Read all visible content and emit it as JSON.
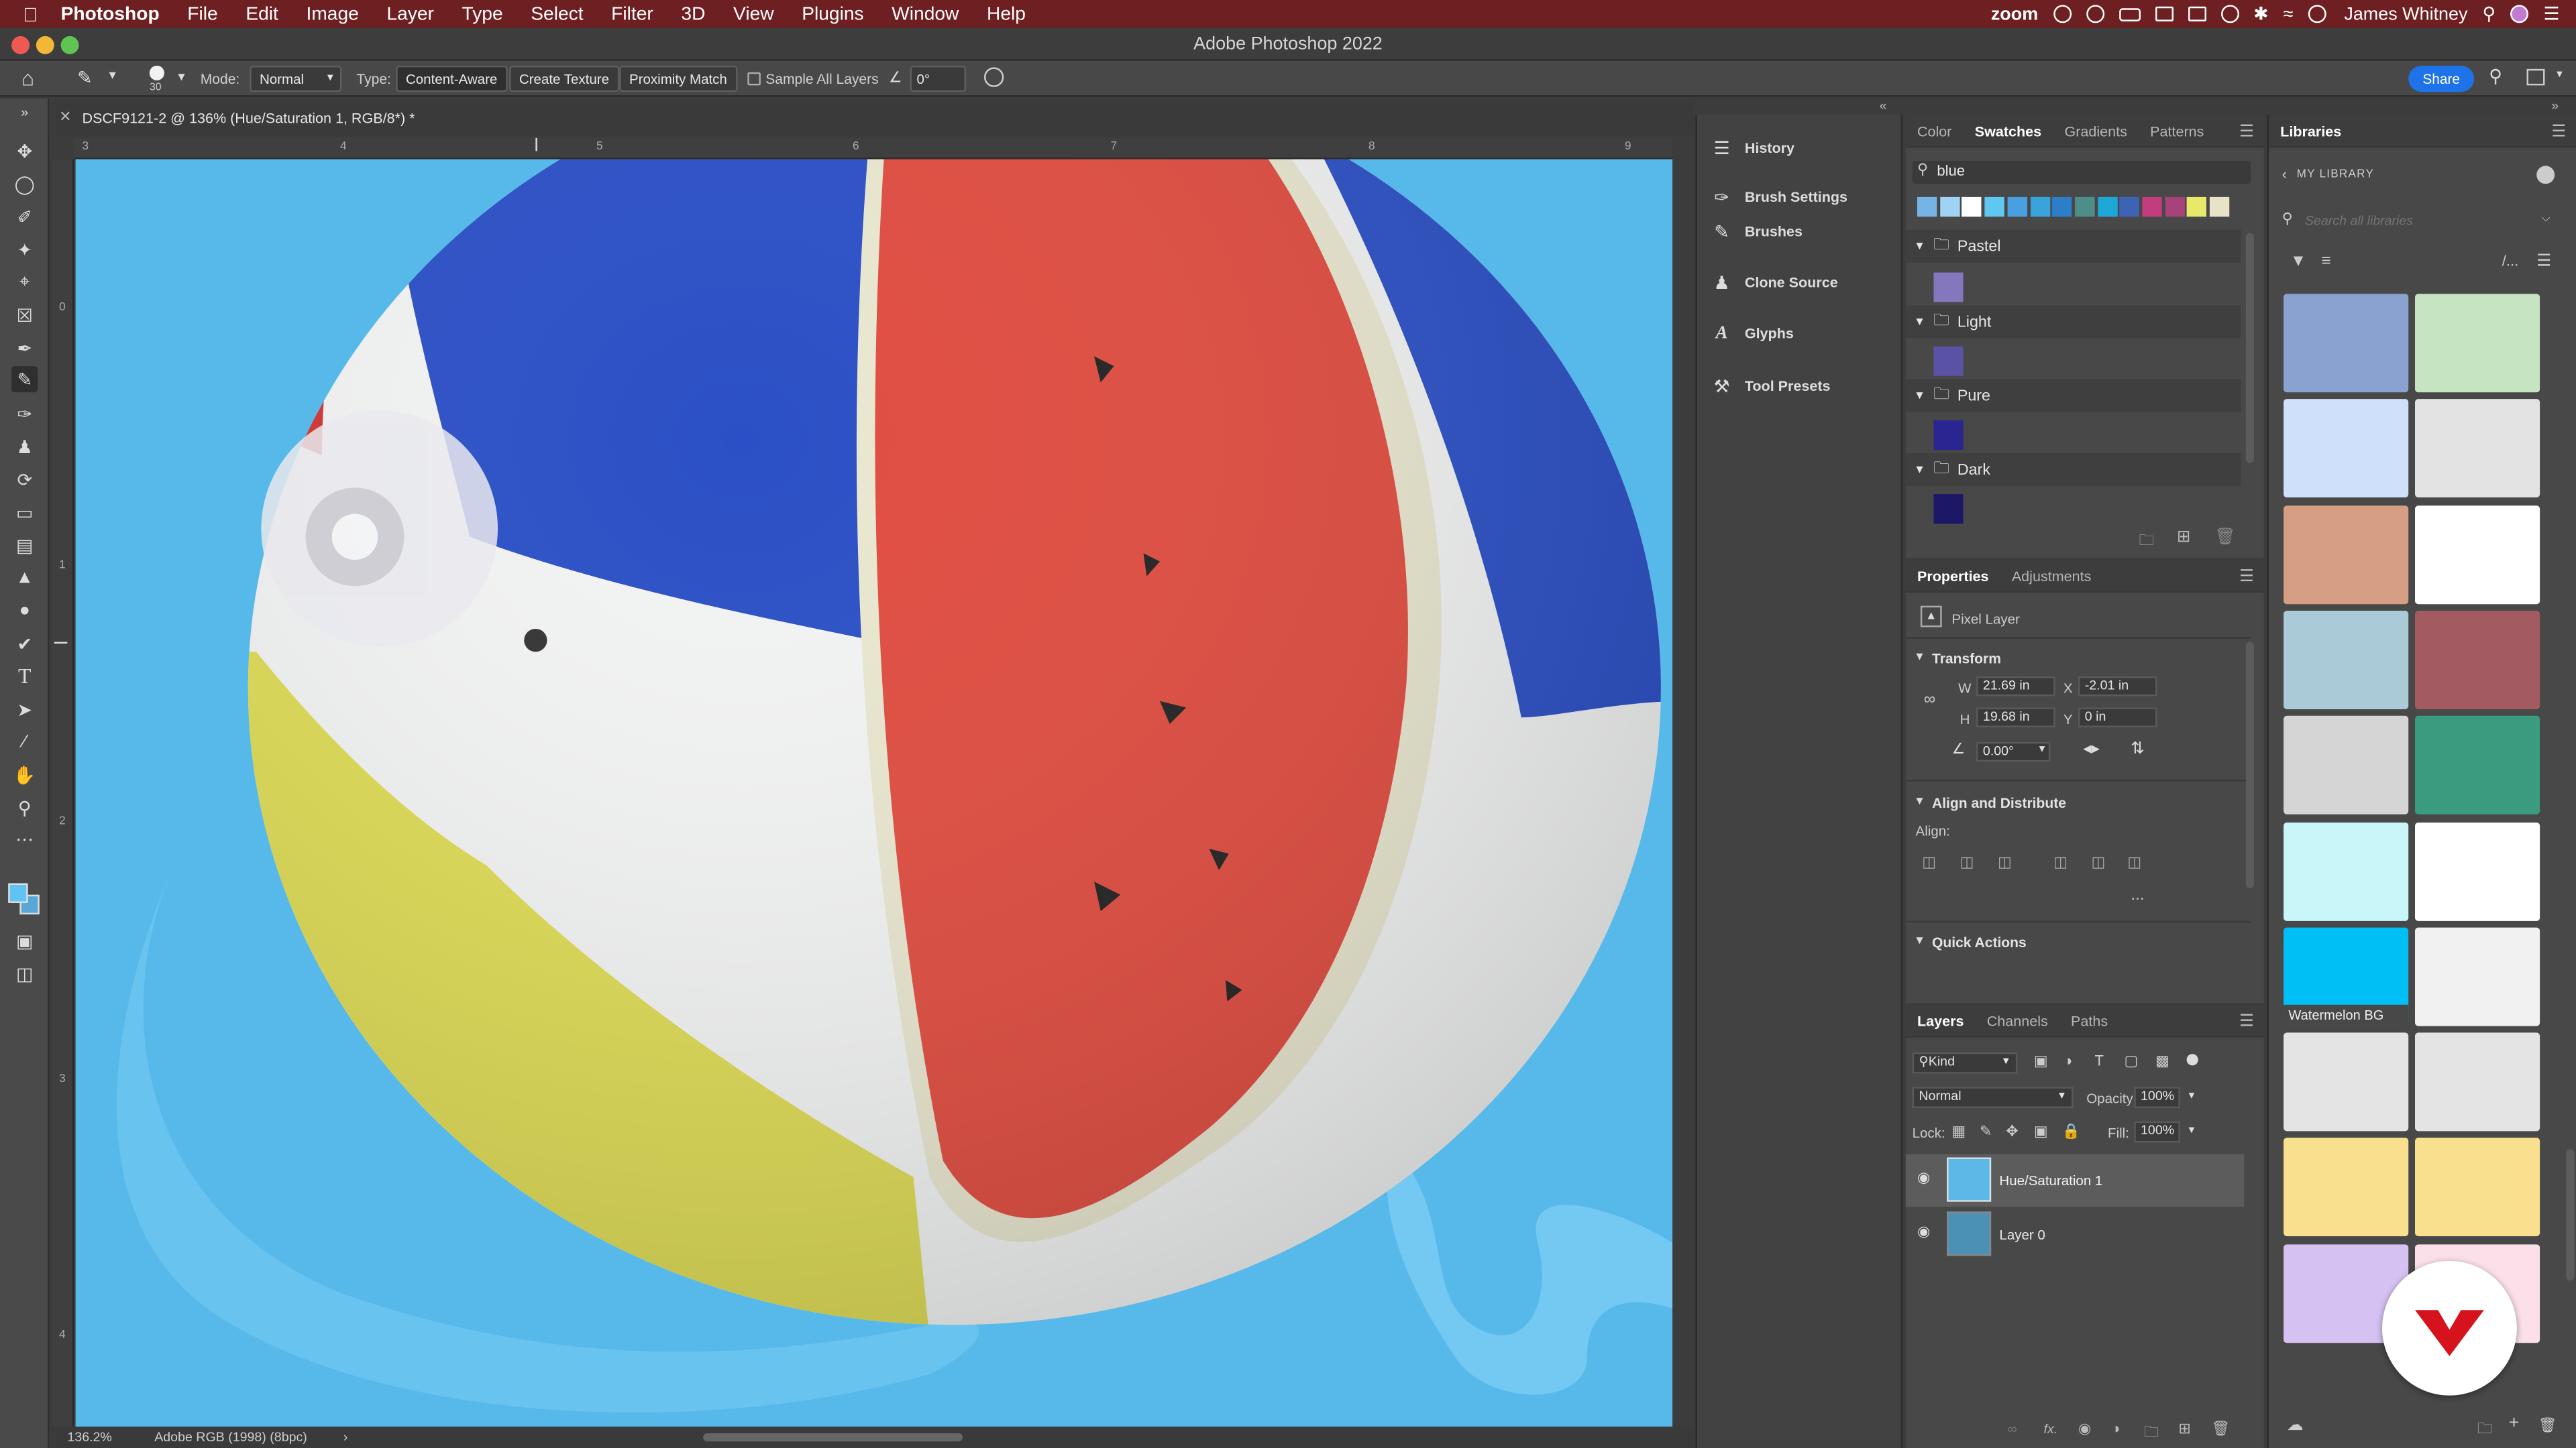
{
  "menubar": {
    "app": "Photoshop",
    "items": [
      "File",
      "Edit",
      "Image",
      "Layer",
      "Type",
      "Select",
      "Filter",
      "3D",
      "View",
      "Plugins",
      "Window",
      "Help"
    ],
    "zoom": "zoom",
    "user": "James Whitney"
  },
  "window_title": "Adobe Photoshop 2022",
  "options": {
    "brush_size": "30",
    "mode_label": "Mode:",
    "mode_value": "Normal",
    "type_label": "Type:",
    "type_content_aware": "Content-Aware",
    "type_create_texture": "Create Texture",
    "type_proximity_match": "Proximity Match",
    "sample_all_layers": "Sample All Layers",
    "angle": "0°",
    "share": "Share"
  },
  "document": {
    "tab_title": "DSCF9121-2 @ 136% (Hue/Saturation 1, RGB/8*) *",
    "ruler_h": [
      "3",
      "4",
      "5",
      "6",
      "7",
      "8",
      "9"
    ],
    "ruler_v": [
      "0",
      "1",
      "2",
      "3",
      "4"
    ],
    "zoom": "136.2%",
    "profile": "Adobe RGB (1998) (8bpc)"
  },
  "dock": {
    "items": [
      "History",
      "Brush Settings",
      "Brushes",
      "Clone Source",
      "Glyphs",
      "Tool Presets"
    ]
  },
  "swatches": {
    "tabs": [
      "Color",
      "Swatches",
      "Gradients",
      "Patterns"
    ],
    "active_tab": "Swatches",
    "search": "blue",
    "row": [
      "#76b4e6",
      "#9fd3f4",
      "#ffffff",
      "#5fc8f0",
      "#4a9fe0",
      "#3aa3dc",
      "#2a7fc8",
      "#4d8f88",
      "#1fa7d8",
      "#3d63b5",
      "#c23c7e",
      "#a8427a",
      "#e8e86a",
      "#e8e2c6"
    ],
    "groups": [
      {
        "name": "Pastel",
        "color": "#8577bd"
      },
      {
        "name": "Light",
        "color": "#5a52a5"
      },
      {
        "name": "Pure",
        "color": "#2a2591"
      },
      {
        "name": "Dark",
        "color": "#1c1766"
      }
    ]
  },
  "properties": {
    "tabs": [
      "Properties",
      "Adjustments"
    ],
    "active_tab": "Properties",
    "layer_type": "Pixel Layer",
    "transform_title": "Transform",
    "w_label": "W",
    "w": "21.69 in",
    "x_label": "X",
    "x": "-2.01 in",
    "h_label": "H",
    "h": "19.68 in",
    "y_label": "Y",
    "y": "0 in",
    "angle": "0.00°",
    "align_title": "Align and Distribute",
    "align_label": "Align:",
    "quick_actions": "Quick Actions",
    "more": "..."
  },
  "layers": {
    "tabs": [
      "Layers",
      "Channels",
      "Paths"
    ],
    "active_tab": "Layers",
    "kind": "Kind",
    "blend": "Normal",
    "opacity_label": "Opacity:",
    "opacity": "100%",
    "lock_label": "Lock:",
    "fill_label": "Fill:",
    "fill": "100%",
    "items": [
      {
        "name": "Hue/Saturation 1",
        "selected": true
      },
      {
        "name": "Layer 0",
        "selected": false
      }
    ]
  },
  "libraries": {
    "tab": "Libraries",
    "breadcrumb": "MY LIBRARY",
    "search_placeholder": "Search all libraries",
    "tile_label": "Watermelon BG",
    "tiles": [
      "#8aa2cf",
      "#c6e3c2",
      "#cfe0fb",
      "#e3e3e3",
      "#d69e84",
      "#ffffff",
      "#a9cad6",
      "#a35a60",
      "#d5d5d5",
      "#3b9b7f",
      "#c9f6f9",
      "#ffffff",
      "#00bff5",
      "#f1f1f1",
      "#e4e4e4",
      "#e4e4e4",
      "#f8e08f",
      "#f8e08f",
      "#d6c2f2",
      "#fbe0ea"
    ]
  }
}
